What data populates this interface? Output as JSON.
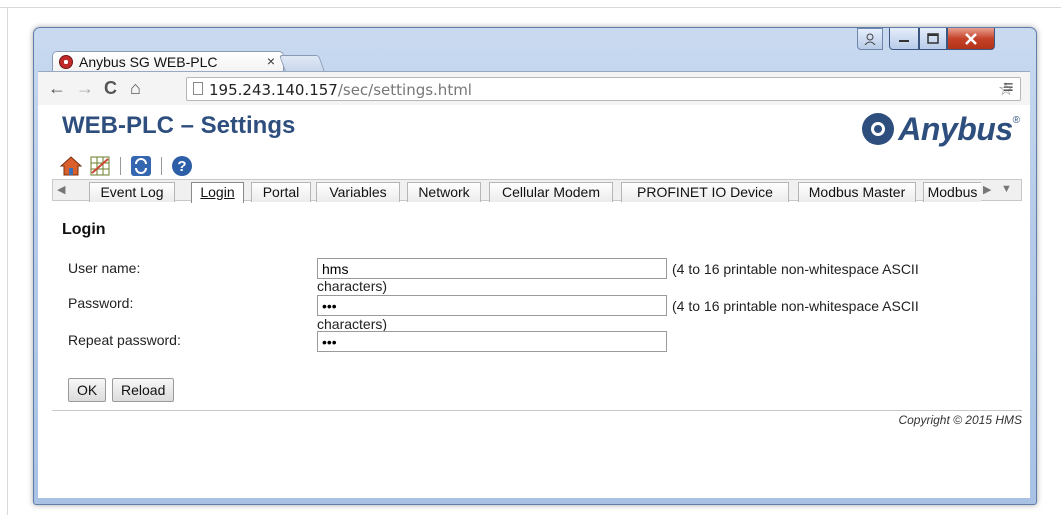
{
  "browser": {
    "tab_title": "Anybus SG WEB-PLC",
    "tab_close": "×",
    "address_host": "195.243.140.157",
    "address_path": "/sec/settings.html",
    "nav_back": "←",
    "nav_forward": "→",
    "nav_reload": "C",
    "nav_home": "⌂",
    "star": "☆",
    "menu": "≡"
  },
  "page": {
    "title": "WEB-PLC – Settings",
    "logo_text": "Anybus",
    "logo_reg": "®",
    "tabs": [
      {
        "label": "Event Log"
      },
      {
        "label": "Login"
      },
      {
        "label": "Portal"
      },
      {
        "label": "Variables"
      },
      {
        "label": "Network"
      },
      {
        "label": "Cellular Modem"
      },
      {
        "label": "PROFINET IO Device"
      },
      {
        "label": "Modbus Master"
      },
      {
        "label": "Modbus"
      }
    ],
    "active_tab": "Login",
    "section_title": "Login",
    "form": {
      "username_label": "User name:",
      "username_value": "hms",
      "password_label": "Password:",
      "password_value": "•••",
      "repeat_label": "Repeat password:",
      "repeat_value": "•••",
      "hint_line1": "(4 to 16 printable non-whitespace ASCII",
      "hint_line2": "characters)"
    },
    "buttons": {
      "ok": "OK",
      "reload": "Reload"
    },
    "copyright": "Copyright © 2015 HMS"
  },
  "colors": {
    "title_blue": "#2e4f7e",
    "close_red": "#c6422a"
  }
}
